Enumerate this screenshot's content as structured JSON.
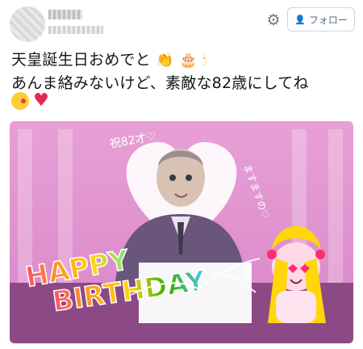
{
  "header": {
    "follow_label": "フォロー",
    "gear_icon": "gear-icon",
    "follow_icon": "person-add-icon"
  },
  "tweet": {
    "line1": "天皇誕生日おめでと",
    "line2": "あんま絡みないけど、素敵な82歳にしてね"
  },
  "photo": {
    "text_top_left": "祝82才♡",
    "text_top_right": "ますますの♡",
    "text_happy": "HAPPY",
    "text_birthday": "BIRTHDAY",
    "colors": {
      "background": "#e7a8d8",
      "table": "#7b3f7a",
      "suit": "#5a4a66"
    }
  }
}
